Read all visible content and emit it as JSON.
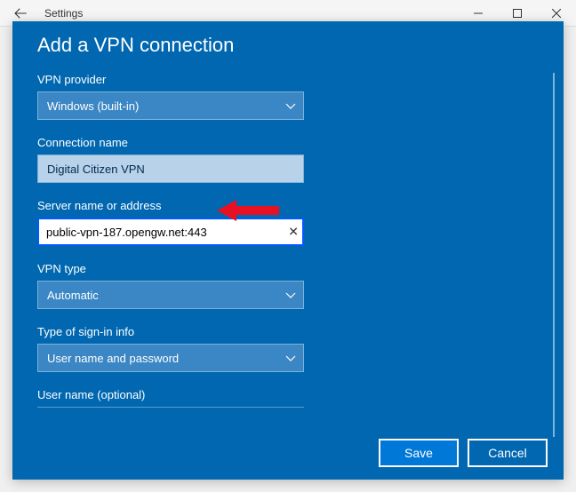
{
  "window": {
    "app_title": "Settings"
  },
  "modal": {
    "title": "Add a VPN connection",
    "fields": {
      "provider": {
        "label": "VPN provider",
        "value": "Windows (built-in)"
      },
      "conn_name": {
        "label": "Connection name",
        "value": "Digital Citizen VPN"
      },
      "server": {
        "label": "Server name or address",
        "value": "public-vpn-187.opengw.net:443"
      },
      "vpn_type": {
        "label": "VPN type",
        "value": "Automatic"
      },
      "signin": {
        "label": "Type of sign-in info",
        "value": "User name and password"
      },
      "username": {
        "label": "User name (optional)"
      }
    },
    "buttons": {
      "save": "Save",
      "cancel": "Cancel"
    }
  }
}
